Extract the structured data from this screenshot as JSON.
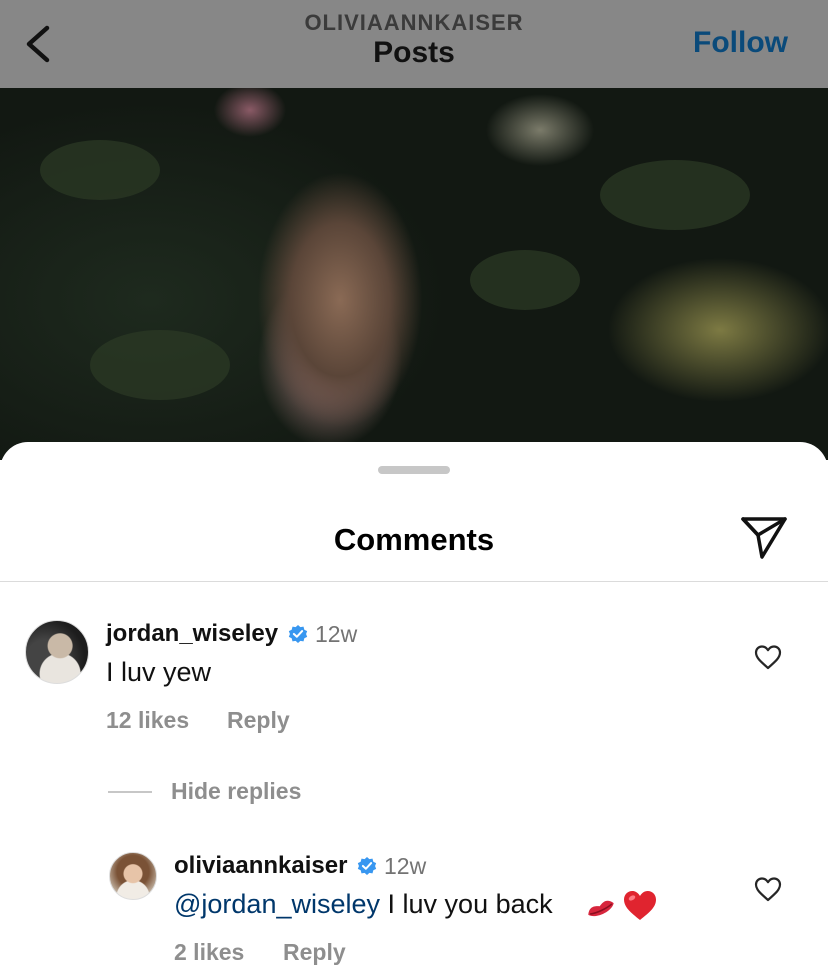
{
  "header": {
    "username": "OLIVIAANNKAISER",
    "title": "Posts",
    "follow_label": "Follow"
  },
  "comments_sheet": {
    "title": "Comments",
    "comments": [
      {
        "username": "jordan_wiseley",
        "verified": true,
        "time": "12w",
        "text": "I luv yew",
        "likes": "12 likes",
        "reply_label": "Reply"
      }
    ],
    "hide_replies_label": "Hide replies",
    "replies": [
      {
        "username": "oliviaannkaiser",
        "verified": true,
        "time": "12w",
        "mention": "@jordan_wiseley",
        "text": "I luv you back",
        "emojis": [
          "kiss-mark-emoji",
          "red-heart-emoji"
        ],
        "likes": "2 likes",
        "reply_label": "Reply"
      }
    ]
  },
  "colors": {
    "verified": "#3897f0",
    "mention": "#00376b",
    "meta": "#8e8e8e",
    "follow": "#0a4a7a"
  }
}
